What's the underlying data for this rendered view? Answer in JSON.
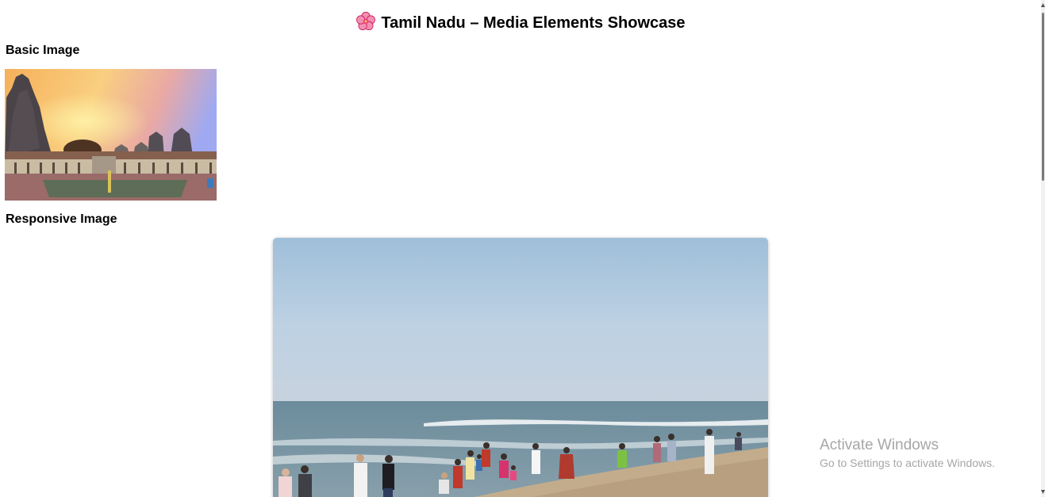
{
  "page": {
    "title": "Tamil Nadu – Media Elements Showcase",
    "title_icon": "flower-icon"
  },
  "sections": {
    "basic_heading": "Basic Image",
    "responsive_heading": "Responsive Image"
  },
  "images": {
    "basic": "temple-photo",
    "responsive": "beach-photo"
  },
  "watermark": {
    "title": "Activate Windows",
    "subtitle": "Go to Settings to activate Windows."
  },
  "colors": {
    "text": "#000000",
    "watermark": "#a6a6a6",
    "flower": "#f48fb1",
    "scrollbar_thumb": "#7a7a7a"
  }
}
